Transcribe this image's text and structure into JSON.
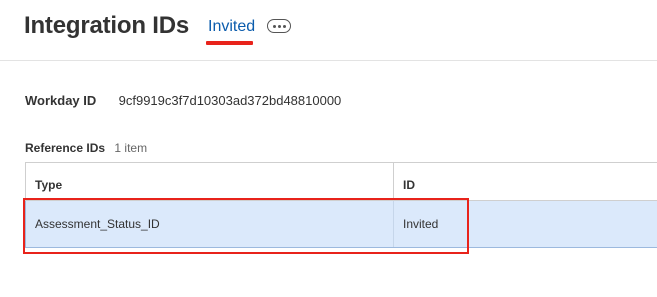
{
  "header": {
    "title": "Integration IDs",
    "subtitle_tab": "Invited"
  },
  "fields": {
    "workday_id_label": "Workday ID",
    "workday_id_value": "9cf9919c3f7d10303ad372bd48810000"
  },
  "reference_ids": {
    "title": "Reference IDs",
    "count": "1 item",
    "columns": [
      "Type",
      "ID"
    ],
    "rows": [
      {
        "type": "Assessment_Status_ID",
        "id": "Invited"
      }
    ]
  },
  "colors": {
    "accent_red": "#e8231b",
    "link_blue": "#0b5cad",
    "selected_row": "#dbe9fb"
  },
  "icons": {
    "related_actions": "more-horizontal-icon"
  }
}
